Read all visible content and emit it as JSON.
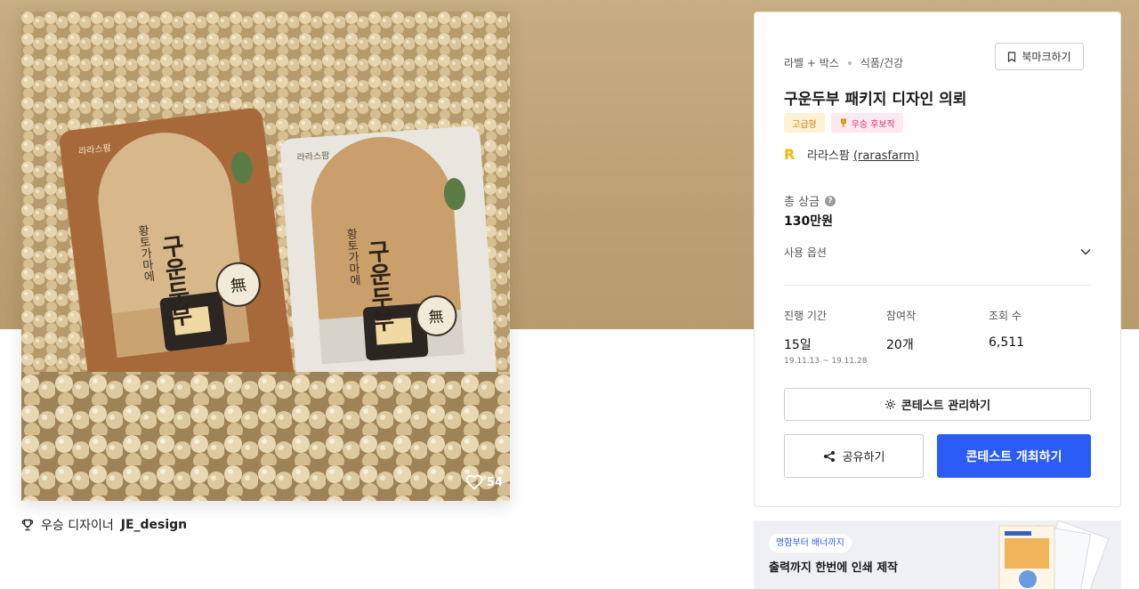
{
  "product": {
    "like_count": "54",
    "winner_prefix": "우승 디자이너",
    "winner_name": "JE_design",
    "package_brand": "라라스팜",
    "package_title": "구운두부",
    "package_subtitle": "황토가마에",
    "package_mark": "無"
  },
  "card": {
    "category": "라벨 + 박스",
    "subcategory": "식품/건강",
    "bookmark_label": "북마크하기",
    "title": "구운두부 패키지 디자인 의뢰",
    "badges": [
      "고급형",
      "우승 후보작"
    ],
    "owner_name": "라라스팜",
    "owner_id": "(rarasfarm)",
    "prize_label": "총 상금",
    "prize_value": "130만원",
    "options_label": "사용 옵션",
    "stats": {
      "period_label": "진행 기간",
      "period_value": "15일",
      "period_dates": "19.11.13 ~ 19.11.28",
      "entries_label": "참여작",
      "entries_value": "20개",
      "views_label": "조회 수",
      "views_value": "6,511"
    },
    "manage_label": "콘테스트 관리하기",
    "share_label": "공유하기",
    "host_label": "콘테스트 개최하기"
  },
  "ad": {
    "pill": "명함부터 배너까지",
    "headline": "출력까지 한번에 인쇄 제작"
  },
  "colors": {
    "primary": "#2b5cf5",
    "hero_bg": "#c6ad82",
    "premium_badge": "#d4820a",
    "award_badge": "#d6336c",
    "owner_logo": "#f5b800"
  }
}
